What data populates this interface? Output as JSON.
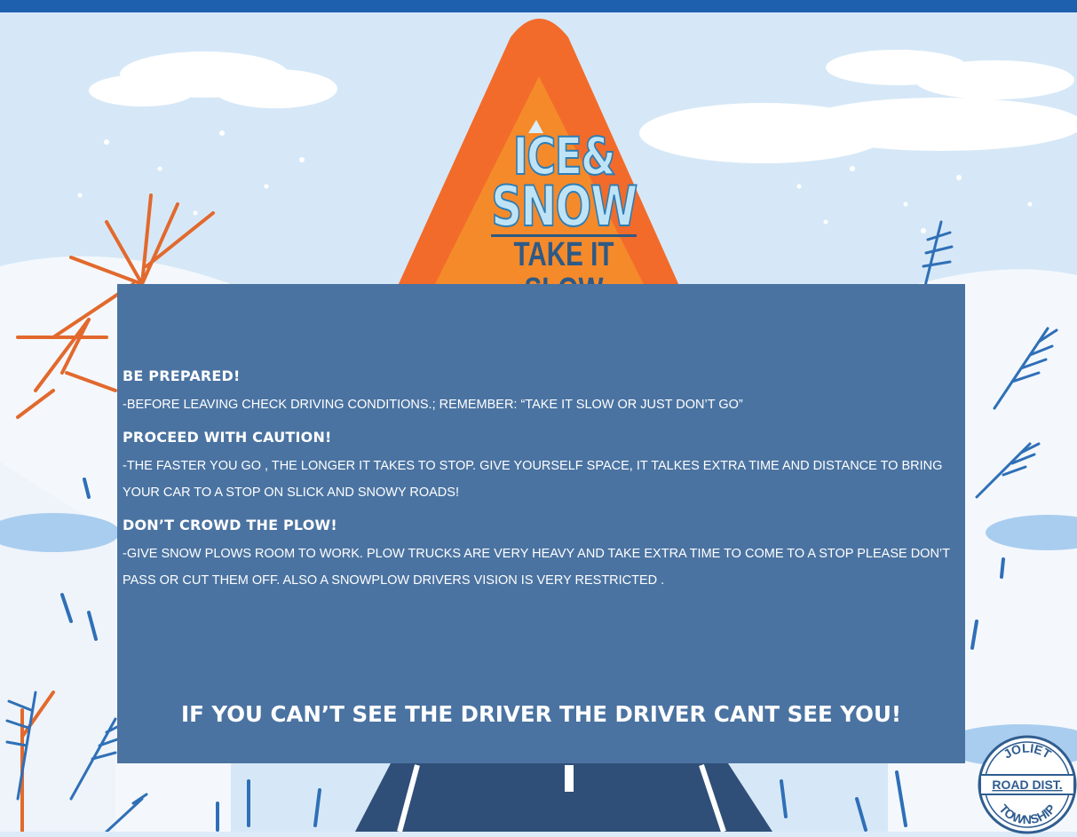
{
  "sign": {
    "line1": "ICE&",
    "line2": "SNOW",
    "line3": "TAKE IT SLOW"
  },
  "sections": [
    {
      "heading": "BE PREPARED!",
      "text": "-BEFORE LEAVING CHECK DRIVING CONDITIONS.; REMEMBER: “TAKE IT SLOW OR JUST DON’T GO”"
    },
    {
      "heading": "PROCEED WITH CAUTION!",
      "text": "-THE FASTER YOU GO , THE LONGER IT TAKES TO STOP. GIVE YOURSELF  SPACE, IT TALKES EXTRA TIME AND DISTANCE TO BRING YOUR CAR TO A STOP ON SLICK AND SNOWY ROADS!"
    },
    {
      "heading": "DON’T CROWD THE PLOW!",
      "text": "-GIVE SNOW PLOWS ROOM TO WORK.  PLOW TRUCKS ARE VERY HEAVY AND TAKE EXTRA TIME TO COME TO A STOP  PLEASE DON’T PASS OR CUT THEM OFF. ALSO A SNOWPLOW DRIVERS VISION IS VERY RESTRICTED ."
    }
  ],
  "slogan": "IF YOU CAN’T SEE THE DRIVER THE DRIVER CANT SEE YOU!",
  "seal": {
    "top": "JOLIET",
    "middle": "ROAD DIST.",
    "bottom": "TOWNSHIP"
  },
  "colors": {
    "panel": "#4a73a1",
    "sign_outer": "#f26b2a",
    "sign_inner": "#f58a2b",
    "sky": "#cfe4f5",
    "road": "#2f4f78",
    "branch_orange": "#e2692d",
    "branch_blue": "#2f6fb7"
  }
}
